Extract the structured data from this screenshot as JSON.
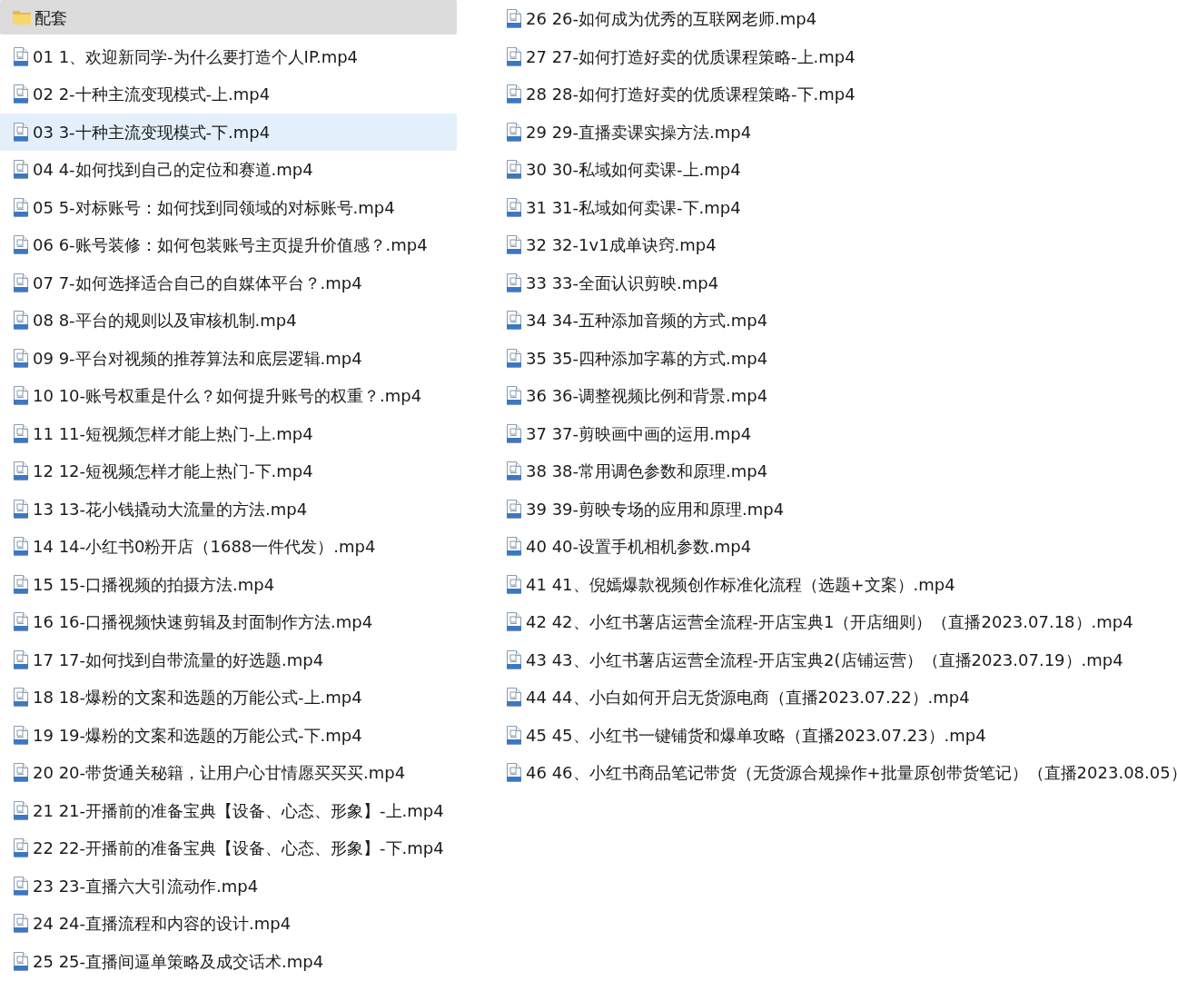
{
  "folder": {
    "name": "配套"
  },
  "columns": [
    {
      "items": [
        {
          "label": "01 1、欢迎新同学-为什么要打造个人IP.mp4",
          "selected": false
        },
        {
          "label": "02 2-十种主流变现模式-上.mp4",
          "selected": false
        },
        {
          "label": "03 3-十种主流变现模式-下.mp4",
          "selected": true
        },
        {
          "label": "04 4-如何找到自己的定位和赛道.mp4",
          "selected": false
        },
        {
          "label": "05 5-对标账号：如何找到同领域的对标账号.mp4",
          "selected": false
        },
        {
          "label": "06 6-账号装修：如何包装账号主页提升价值感？.mp4",
          "selected": false
        },
        {
          "label": "07 7-如何选择适合自己的自媒体平台？.mp4",
          "selected": false
        },
        {
          "label": "08 8-平台的规则以及审核机制.mp4",
          "selected": false
        },
        {
          "label": "09 9-平台对视频的推荐算法和底层逻辑.mp4",
          "selected": false
        },
        {
          "label": "10 10-账号权重是什么？如何提升账号的权重？.mp4",
          "selected": false
        },
        {
          "label": "11 11-短视频怎样才能上热门-上.mp4",
          "selected": false
        },
        {
          "label": "12 12-短视频怎样才能上热门-下.mp4",
          "selected": false
        },
        {
          "label": "13 13-花小钱撬动大流量的方法.mp4",
          "selected": false
        },
        {
          "label": "14 14-小红书0粉开店（1688一件代发）.mp4",
          "selected": false
        },
        {
          "label": "15 15-口播视频的拍摄方法.mp4",
          "selected": false
        },
        {
          "label": "16 16-口播视频快速剪辑及封面制作方法.mp4",
          "selected": false
        },
        {
          "label": "17 17-如何找到自带流量的好选题.mp4",
          "selected": false
        },
        {
          "label": "18 18-爆粉的文案和选题的万能公式-上.mp4",
          "selected": false
        },
        {
          "label": "19 19-爆粉的文案和选题的万能公式-下.mp4",
          "selected": false
        },
        {
          "label": "20 20-带货通关秘籍，让用户心甘情愿买买买.mp4",
          "selected": false
        },
        {
          "label": "21 21-开播前的准备宝典【设备、心态、形象】-上.mp4",
          "selected": false
        },
        {
          "label": "22 22-开播前的准备宝典【设备、心态、形象】-下.mp4",
          "selected": false
        },
        {
          "label": "23 23-直播六大引流动作.mp4",
          "selected": false
        },
        {
          "label": "24 24-直播流程和内容的设计.mp4",
          "selected": false
        },
        {
          "label": "25 25-直播间逼单策略及成交话术.mp4",
          "selected": false
        }
      ]
    },
    {
      "items": [
        {
          "label": "26 26-如何成为优秀的互联网老师.mp4",
          "selected": false
        },
        {
          "label": "27 27-如何打造好卖的优质课程策略-上.mp4",
          "selected": false
        },
        {
          "label": "28 28-如何打造好卖的优质课程策略-下.mp4",
          "selected": false
        },
        {
          "label": "29 29-直播卖课实操方法.mp4",
          "selected": false
        },
        {
          "label": "30 30-私域如何卖课-上.mp4",
          "selected": false
        },
        {
          "label": "31 31-私域如何卖课-下.mp4",
          "selected": false
        },
        {
          "label": "32 32-1v1成单诀窍.mp4",
          "selected": false
        },
        {
          "label": "33 33-全面认识剪映.mp4",
          "selected": false
        },
        {
          "label": "34 34-五种添加音频的方式.mp4",
          "selected": false
        },
        {
          "label": "35 35-四种添加字幕的方式.mp4",
          "selected": false
        },
        {
          "label": "36 36-调整视频比例和背景.mp4",
          "selected": false
        },
        {
          "label": "37 37-剪映画中画的运用.mp4",
          "selected": false
        },
        {
          "label": "38 38-常用调色参数和原理.mp4",
          "selected": false
        },
        {
          "label": "39 39-剪映专场的应用和原理.mp4",
          "selected": false
        },
        {
          "label": "40 40-设置手机相机参数.mp4",
          "selected": false
        },
        {
          "label": "41 41、倪嫣爆款视频创作标准化流程（选题+文案）.mp4",
          "selected": false
        },
        {
          "label": "42 42、小红书薯店运营全流程-开店宝典1（开店细则）（直播2023.07.18）.mp4",
          "selected": false
        },
        {
          "label": "43 43、小红书薯店运营全流程-开店宝典2(店铺运营）（直播2023.07.19）.mp4",
          "selected": false
        },
        {
          "label": "44 44、小白如何开启无货源电商（直播2023.07.22）.mp4",
          "selected": false
        },
        {
          "label": "45 45、小红书一键铺货和爆单攻略（直播2023.07.23）.mp4",
          "selected": false
        },
        {
          "label": "46 46、小红书商品笔记带货（无货源合规操作+批量原创带货笔记）（直播2023.08.05）",
          "selected": false
        }
      ]
    }
  ]
}
